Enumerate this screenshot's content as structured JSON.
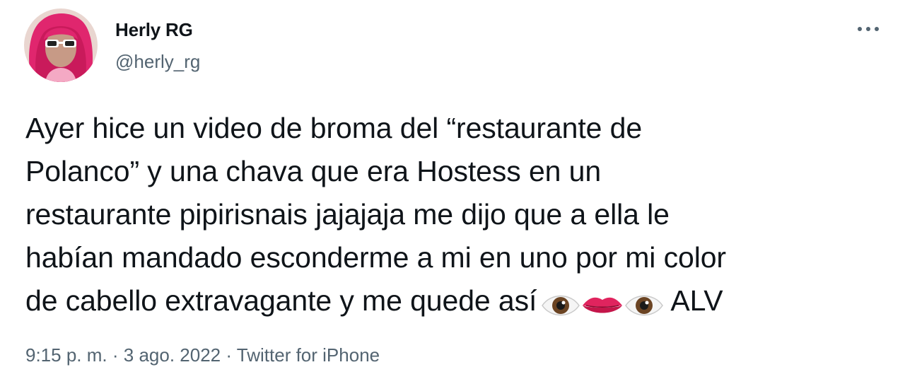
{
  "author": {
    "display_name": "Herly RG",
    "handle": "@herly_rg",
    "avatar_icon": "user-avatar"
  },
  "menu": {
    "more_icon": "more-horizontal-icon"
  },
  "tweet": {
    "lines": [
      "Ayer hice un video de broma del “restaurante de",
      "Polanco” y una chava que era Hostess en un",
      "restaurante pipirisnais jajajaja me dijo que a ella le",
      "habían mandado esconderme a mi en uno por mi color",
      "de cabello extravagante y me quede así"
    ],
    "emojis": [
      "eye-emoji",
      "lips-emoji",
      "eye-emoji"
    ],
    "trailing_text": "ALV"
  },
  "meta": {
    "time": "9:15 p. m.",
    "separator": "·",
    "date": "3 ago. 2022",
    "source": "Twitter for iPhone"
  },
  "colors": {
    "text": "#0f1419",
    "secondary": "#536471",
    "background": "#ffffff"
  }
}
